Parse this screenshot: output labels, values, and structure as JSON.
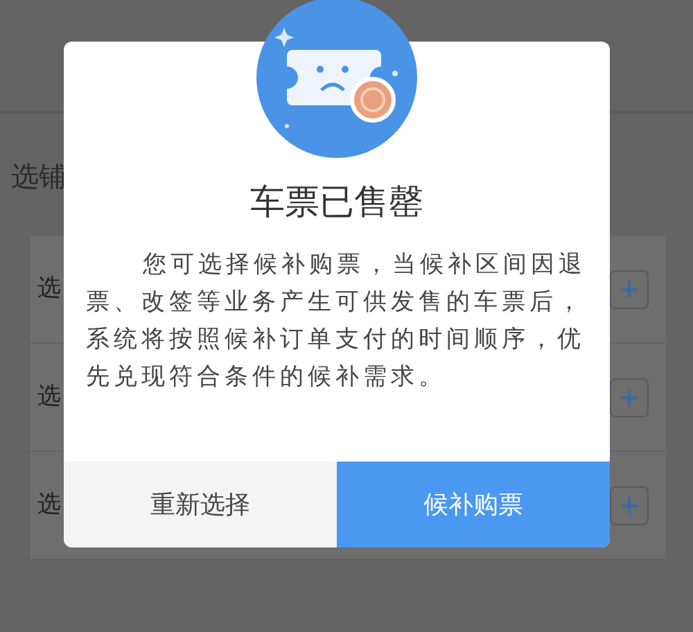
{
  "background_page": {
    "heading": "选铺",
    "rows": [
      {
        "label": "选"
      },
      {
        "label": "选"
      },
      {
        "label": "选"
      }
    ]
  },
  "dialog": {
    "title": "车票已售罄",
    "message": "您可选择候补购票，当候补区间因退票、改签等业务产生可供发售的车票后，系统将按照候补订单支付的时间顺序，优先兑现符合条件的候补需求。",
    "buttons": [
      {
        "label": "重新选择",
        "kind": "secondary"
      },
      {
        "label": "候补购票",
        "kind": "primary"
      }
    ]
  }
}
